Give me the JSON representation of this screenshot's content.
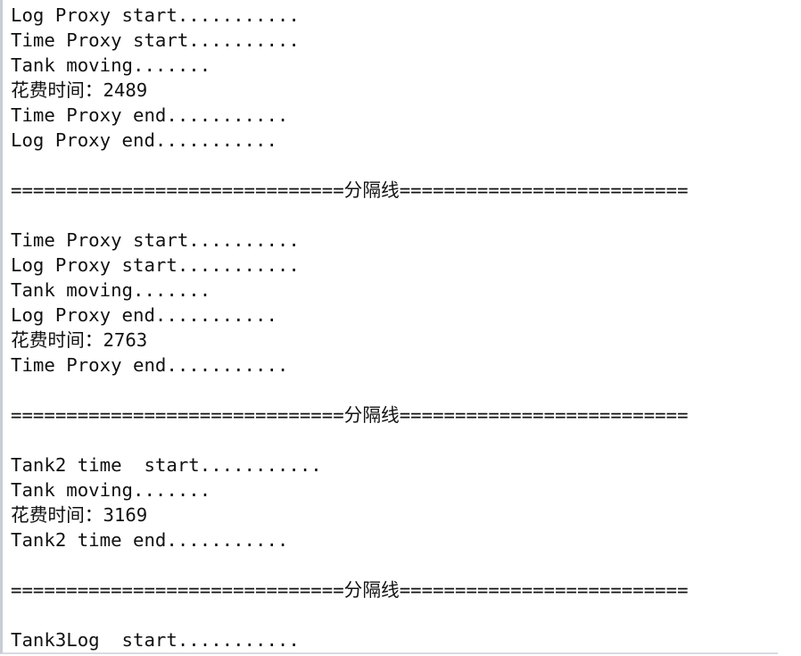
{
  "console": {
    "lines": [
      "Log Proxy start...........",
      "Time Proxy start..........",
      "Tank moving.......",
      "花费时间：2489",
      "Time Proxy end...........",
      "Log Proxy end...........",
      "",
      "==============================分隔线==========================",
      "",
      "Time Proxy start..........",
      "Log Proxy start...........",
      "Tank moving.......",
      "Log Proxy end...........",
      "花费时间：2763",
      "Time Proxy end...........",
      "",
      "==============================分隔线==========================",
      "",
      "Tank2 time  start...........",
      "Tank moving.......",
      "花费时间：3169",
      "Tank2 time end...........",
      "",
      "==============================分隔线==========================",
      "",
      "Tank3Log  start..........."
    ]
  }
}
